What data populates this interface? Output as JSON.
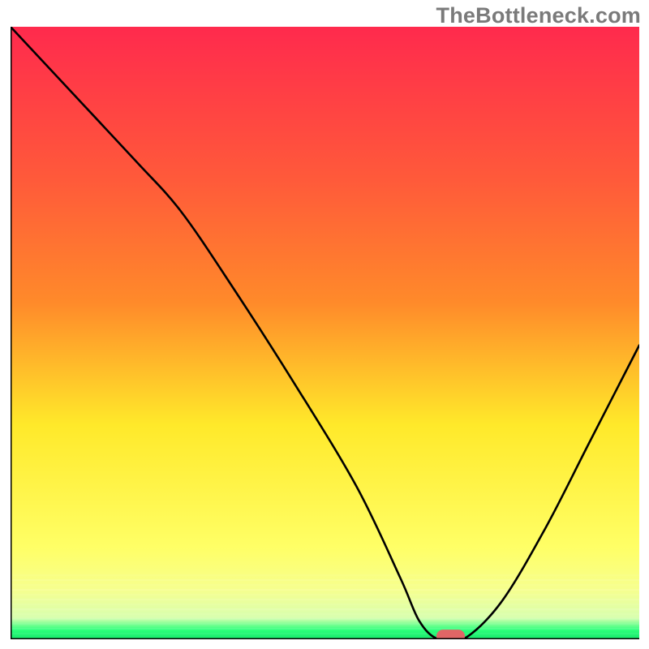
{
  "watermark": "TheBottleneck.com",
  "colors": {
    "gradient_top": "#ff2a4d",
    "gradient_mid1": "#ff8a2a",
    "gradient_mid2": "#ffe92a",
    "gradient_low": "#f6ff8f",
    "gradient_green": "#2bff7a",
    "curve": "#000000",
    "marker_fill": "#e06666",
    "marker_stroke": "#e06666",
    "axis": "#000000"
  },
  "chart_data": {
    "type": "line",
    "title": "",
    "xlabel": "",
    "ylabel": "",
    "xlim": [
      0,
      100
    ],
    "ylim": [
      0,
      100
    ],
    "series": [
      {
        "name": "bottleneck-curve",
        "x": [
          0,
          10,
          20,
          27,
          35,
          45,
          55,
          62,
          65,
          68,
          72,
          78,
          85,
          92,
          100
        ],
        "values": [
          100,
          89,
          78,
          70,
          58,
          42,
          25,
          10,
          3,
          0,
          0,
          6,
          18,
          32,
          48
        ]
      }
    ],
    "marker": {
      "x": 70,
      "y": 0.5,
      "rx": 2.2,
      "ry": 1.0
    },
    "annotations": []
  }
}
